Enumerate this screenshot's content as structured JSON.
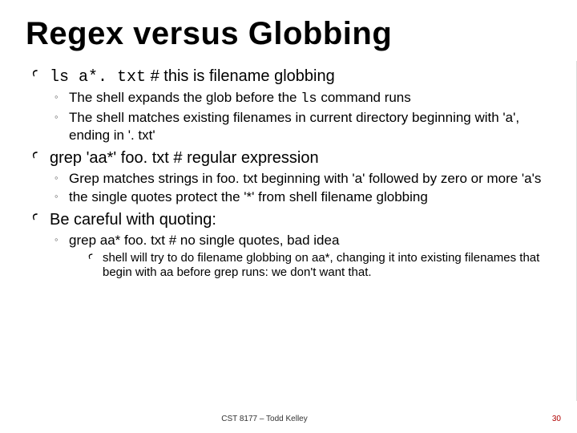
{
  "title": "Regex versus Globbing",
  "bullets": [
    {
      "code": "ls a*. txt",
      "rest": "   # this is filename globbing",
      "subs": [
        {
          "pre": "The shell expands the glob before the ",
          "code": "ls",
          "post": " command runs"
        },
        {
          "pre": "The shell matches existing filenames in current directory beginning with 'a', ending in '. txt'",
          "code": "",
          "post": ""
        }
      ]
    },
    {
      "code": "",
      "rest": "grep 'aa*' foo. txt  # regular expression",
      "subs": [
        {
          "pre": " Grep matches strings in foo. txt beginning with 'a' followed by zero or more 'a's",
          "code": "",
          "post": ""
        },
        {
          "pre": "the single quotes protect the '*' from shell filename globbing",
          "code": "",
          "post": ""
        }
      ]
    },
    {
      "code": "",
      "rest": "Be careful with quoting:",
      "subs": [
        {
          "pre": "grep aa* foo. txt  # no single quotes,  bad idea",
          "code": "",
          "post": "",
          "subsub": "shell will try to do filename globbing on aa*, changing it into existing filenames that begin with aa before grep runs: we don't want that."
        }
      ]
    }
  ],
  "icons": {
    "main": "Ꜥ",
    "sub": "◦",
    "subsub": "Ꜥ"
  },
  "footer": {
    "credit": "CST 8177 – Todd Kelley",
    "page": "30"
  }
}
